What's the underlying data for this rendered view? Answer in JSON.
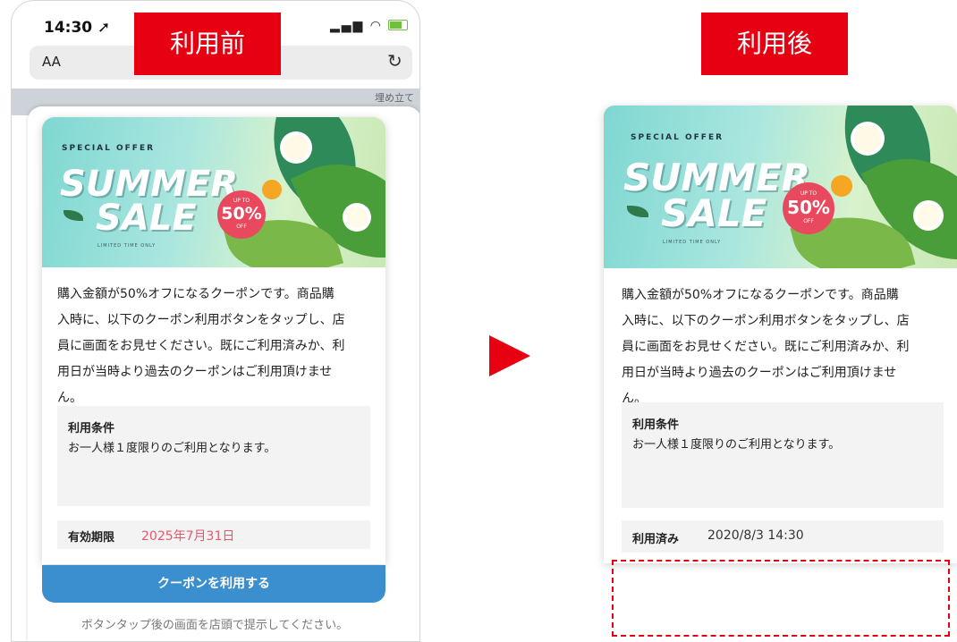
{
  "labels": {
    "before": "利用前",
    "after": "利用後"
  },
  "phone": {
    "time": "14:30",
    "location_icon": "location-arrow-icon",
    "signal_wifi": "📶 ᯤ",
    "aa": "AA",
    "reload_icon": "reload-icon",
    "map_text": "埋め立て"
  },
  "banner": {
    "special": "SPECIAL OFFER",
    "summer": "SUMMER",
    "sale": "SALE",
    "limited": "LIMITED TIME ONLY",
    "badge_up": "UP TO",
    "badge_pct": "50%",
    "badge_off": "OFF"
  },
  "coupon": {
    "description_lines": [
      "購入金額が50%オフになるクーポンです。商品購",
      "入時に、以下のクーポン利用ボタンをタップし、店",
      "員に画面をお見せください。既にご利用済みか、利",
      "用日が当時より過去のクーポンはご利用頂けませ",
      "ん。"
    ],
    "condition_title": "利用条件",
    "condition_text": "お一人様１度限りのご利用となります。",
    "expiry_label": "有効期限",
    "expiry_value": "2025年7月31日",
    "use_button": "クーポンを利用する",
    "hint": "ボタンタップ後の画面を店頭で提示してください。"
  },
  "after": {
    "used_label": "利用済み",
    "used_value": "2020/8/3 14:30"
  },
  "colors": {
    "accent_red": "#e60012",
    "button_blue": "#3b8fcf",
    "expiry_pink": "#e8566c"
  }
}
